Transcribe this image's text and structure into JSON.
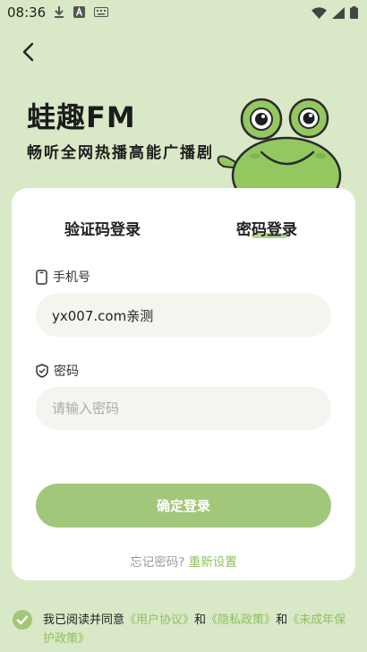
{
  "status": {
    "time": "08:36",
    "left_icons": [
      "download-icon",
      "a-box-icon",
      "keyboard-icon"
    ],
    "right_icons": [
      "wifi-icon",
      "signal-icon",
      "battery-icon"
    ]
  },
  "brand": {
    "title": "蛙趣FM",
    "subtitle": "畅听全网热播高能广播剧"
  },
  "tabs": [
    {
      "label": "验证码登录",
      "active": false
    },
    {
      "label": "密码登录",
      "active": true
    }
  ],
  "form": {
    "phone_label": "手机号",
    "phone_value": "yx007.com亲测",
    "password_label": "密码",
    "password_placeholder": "请输入密码",
    "confirm_label": "确定登录"
  },
  "forgot": {
    "question": "忘记密码?",
    "link": "重新设置"
  },
  "agreement": {
    "prefix": "我已阅读并同意",
    "user_agreement": "《用户协议》",
    "and1": "和",
    "privacy_policy": "《隐私政策》",
    "and2": "和",
    "minor_policy": "《未成年保护政策》"
  },
  "colors": {
    "background": "#d9e8c6",
    "accent": "#a1c77a",
    "link": "#8fbf62",
    "frog": "#93c860"
  }
}
